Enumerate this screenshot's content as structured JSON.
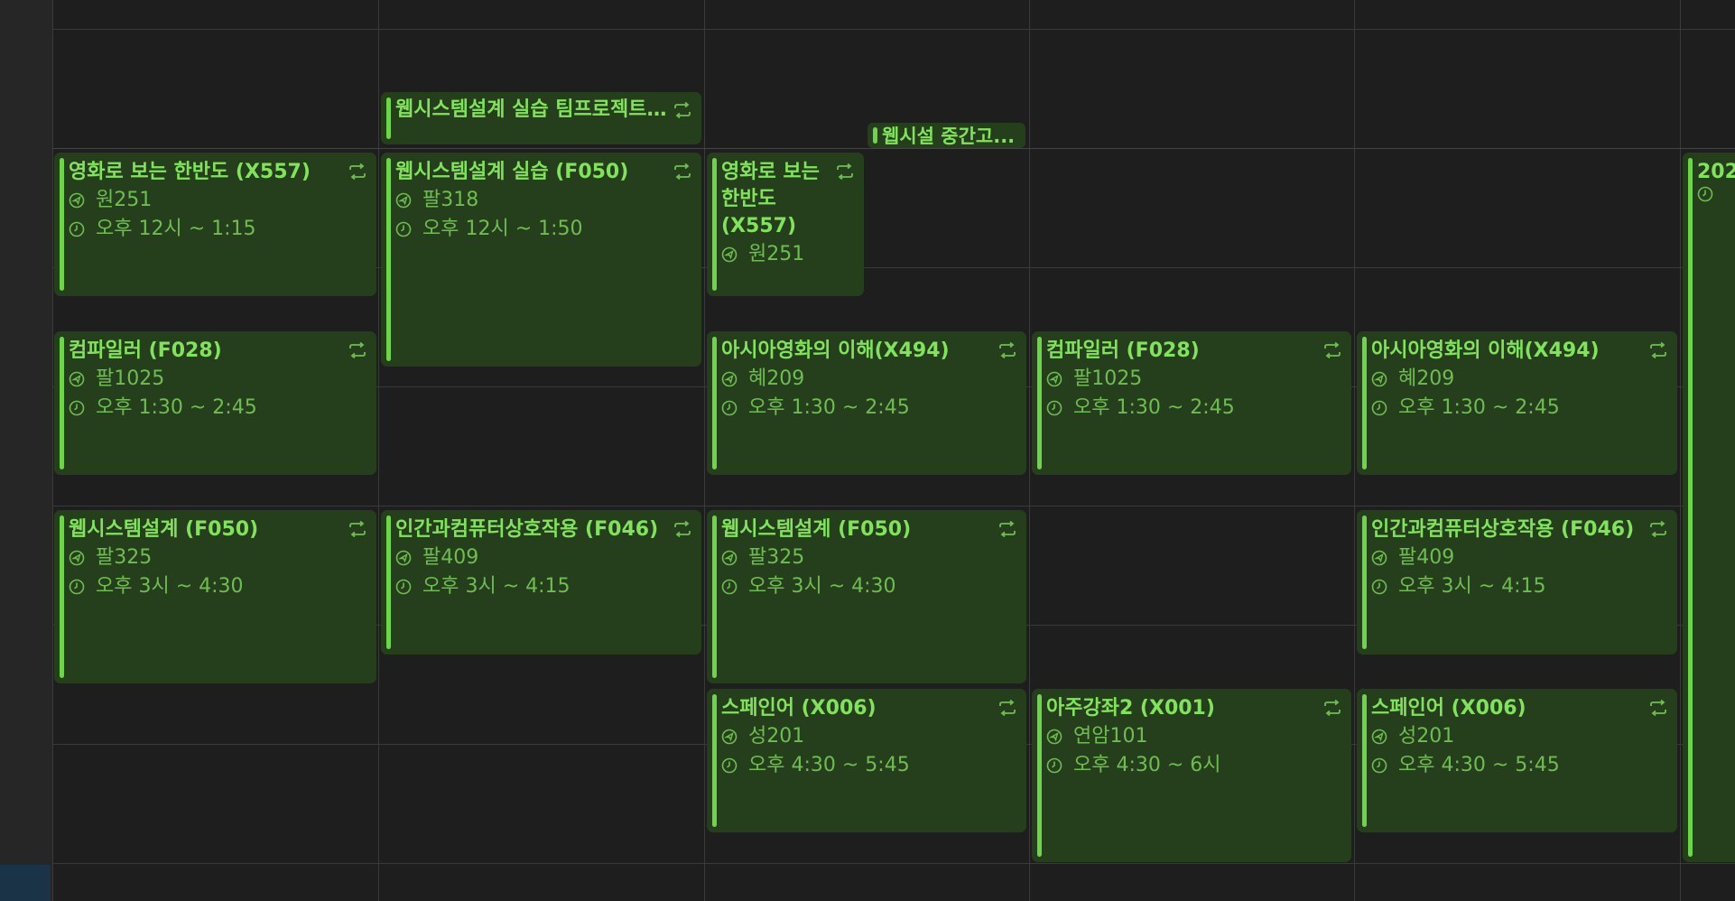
{
  "week": {
    "allday": {
      "tue": {
        "title": "웹시스템설계 실습 팀프로젝트..."
      },
      "wed": {
        "title": "웹시설 중간고..."
      }
    },
    "mon": {
      "e1": {
        "title": "영화로 보는 한반도 (X557)",
        "location": "원251",
        "time": "오후 12시 ~ 1:15"
      },
      "e2": {
        "title": "컴파일러 (F028)",
        "location": "팔1025",
        "time": "오후 1:30 ~ 2:45"
      },
      "e3": {
        "title": "웹시스템설계 (F050)",
        "location": "팔325",
        "time": "오후 3시 ~ 4:30"
      }
    },
    "tue": {
      "e1": {
        "title": "웹시스템설계 실습 (F050)",
        "location": "팔318",
        "time": "오후 12시 ~ 1:50"
      },
      "e2": {
        "title": "인간과컴퓨터상호작용 (F046)",
        "location": "팔409",
        "time": "오후 3시 ~ 4:15"
      }
    },
    "wed": {
      "e1": {
        "title": "영화로 보는 한반도 (X557)",
        "location": "원251"
      },
      "e2": {
        "title": "아시아영화의 이해(X494)",
        "location": "혜209",
        "time": "오후 1:30 ~ 2:45"
      },
      "e3": {
        "title": "웹시스템설계 (F050)",
        "location": "팔325",
        "time": "오후 3시 ~ 4:30"
      },
      "e4": {
        "title": "스페인어 (X006)",
        "location": "성201",
        "time": "오후 4:30 ~ 5:45"
      }
    },
    "thu": {
      "e1": {
        "title": "컴파일러 (F028)",
        "location": "팔1025",
        "time": "오후 1:30 ~ 2:45"
      },
      "e2": {
        "title": "아주강좌2 (X001)",
        "location": "연암101",
        "time": "오후 4:30 ~ 6시"
      }
    },
    "fri": {
      "e1": {
        "title": "아시아영화의 이해(X494)",
        "location": "혜209",
        "time": "오후 1:30 ~ 2:45"
      },
      "e2": {
        "title": "인간과컴퓨터상호작용 (F046)",
        "location": "팔409",
        "time": "오후 3시 ~ 4:15"
      },
      "e3": {
        "title": "스페인어 (X006)",
        "location": "성201",
        "time": "오후 4:30 ~ 5:45"
      }
    },
    "sat": {
      "e1": {
        "title": "202"
      }
    }
  },
  "icons": {
    "location": "location-pin-icon",
    "time": "clock-icon",
    "repeat": "repeat-icon"
  },
  "colors": {
    "event_bg": "#253f1d",
    "event_text": "#82e25e",
    "event_bar": "#6fd44b",
    "background": "#1e1e1e"
  }
}
